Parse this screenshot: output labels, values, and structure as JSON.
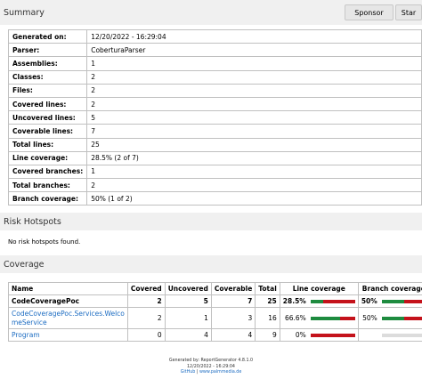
{
  "summary": {
    "title": "Summary",
    "sponsor_label": "Sponsor",
    "star_label": "Star",
    "rows": [
      {
        "k": "Generated on:",
        "v": "12/20/2022 - 16:29:04"
      },
      {
        "k": "Parser:",
        "v": "CoberturaParser"
      },
      {
        "k": "Assemblies:",
        "v": "1"
      },
      {
        "k": "Classes:",
        "v": "2"
      },
      {
        "k": "Files:",
        "v": "2"
      },
      {
        "k": "Covered lines:",
        "v": "2"
      },
      {
        "k": "Uncovered lines:",
        "v": "5"
      },
      {
        "k": "Coverable lines:",
        "v": "7"
      },
      {
        "k": "Total lines:",
        "v": "25"
      },
      {
        "k": "Line coverage:",
        "v": "28.5% (2 of 7)"
      },
      {
        "k": "Covered branches:",
        "v": "1"
      },
      {
        "k": "Total branches:",
        "v": "2"
      },
      {
        "k": "Branch coverage:",
        "v": "50% (1 of 2)"
      }
    ]
  },
  "risk": {
    "title": "Risk Hotspots",
    "empty_text": "No risk hotspots found."
  },
  "coverage": {
    "title": "Coverage",
    "headers": {
      "name": "Name",
      "covered": "Covered",
      "uncovered": "Uncovered",
      "coverable": "Coverable",
      "total": "Total",
      "line_coverage": "Line coverage",
      "branch_coverage": "Branch coverage"
    },
    "group": {
      "name": "CodeCoveragePoc",
      "covered": "2",
      "uncovered": "5",
      "coverable": "7",
      "total": "25",
      "line_pct": "28.5%",
      "line_fraction": 0.285,
      "branch_pct": "50%",
      "branch_fraction": 0.5
    },
    "classes": [
      {
        "name_line1": "CodeCoveragePoc.Services.Welco",
        "name_line2": "meService",
        "covered": "2",
        "uncovered": "1",
        "coverable": "3",
        "total": "16",
        "line_pct": "66.6%",
        "line_fraction": 0.666,
        "branch_pct": "50%",
        "branch_fraction": 0.5
      },
      {
        "name_line1": "Program",
        "covered": "0",
        "uncovered": "4",
        "coverable": "4",
        "total": "9",
        "line_pct": "0%",
        "line_fraction": 0.0,
        "branch_pct": "",
        "branch_fraction": null
      }
    ]
  },
  "footer": {
    "line1": "Generated by: ReportGenerator 4.8.1.0",
    "line2": "12/20/2022 - 16:29:04",
    "github": "GitHub",
    "separator": " | ",
    "site": "www.palmmedia.de"
  },
  "colors": {
    "covered": "#1e8b3f",
    "uncovered": "#c4121b",
    "none": "#dcdcdc",
    "link": "#1c6cc2"
  }
}
